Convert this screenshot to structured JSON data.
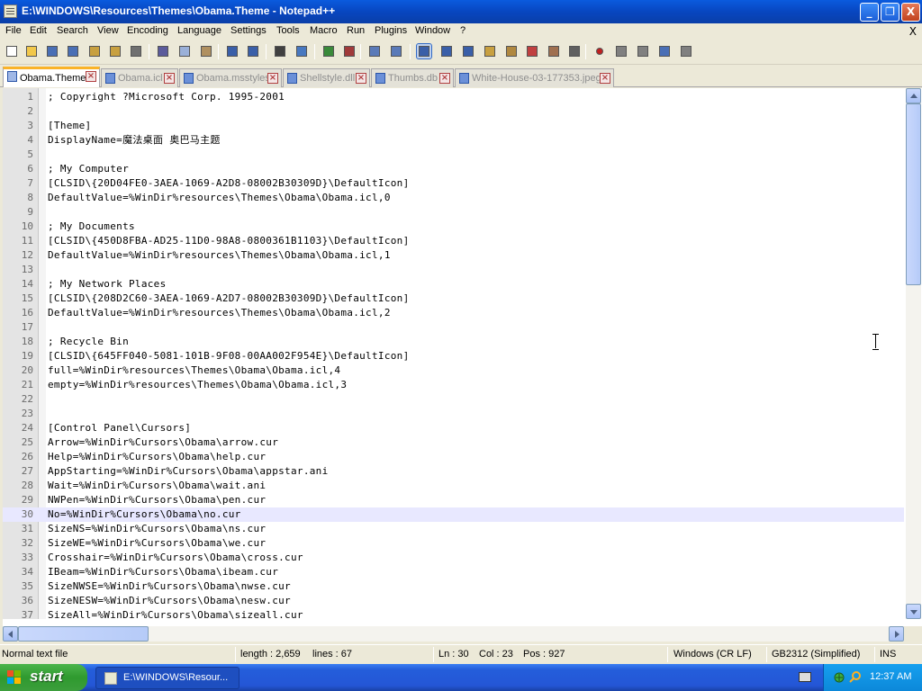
{
  "window": {
    "title": "E:\\WINDOWS\\Resources\\Themes\\Obama.Theme - Notepad++",
    "minimize_glyph": "_",
    "maximize_glyph": "❐",
    "close_glyph": "X"
  },
  "menu": {
    "items": [
      "File",
      "Edit",
      "Search",
      "View",
      "Encoding",
      "Language",
      "Settings",
      "Tools",
      "Macro",
      "Run",
      "Plugins",
      "Window",
      "?"
    ],
    "doc_close": "X"
  },
  "toolbar": {
    "buttons": [
      {
        "name": "new-file-icon",
        "color": "#ffffff"
      },
      {
        "name": "open-file-icon",
        "color": "#f2c84b"
      },
      {
        "name": "save-icon",
        "color": "#4a6fb5"
      },
      {
        "name": "save-all-icon",
        "color": "#4a6fb5"
      },
      {
        "name": "close-icon",
        "color": "#c8a040"
      },
      {
        "name": "close-all-icon",
        "color": "#c8a040"
      },
      {
        "name": "print-icon",
        "color": "#707070"
      },
      {
        "name": "cut-icon",
        "color": "#5b5b9b"
      },
      {
        "name": "copy-icon",
        "color": "#9ab0d8"
      },
      {
        "name": "paste-icon",
        "color": "#b09060"
      },
      {
        "name": "undo-icon",
        "color": "#3a5fa8"
      },
      {
        "name": "redo-icon",
        "color": "#3a5fa8"
      },
      {
        "name": "find-icon",
        "color": "#404040"
      },
      {
        "name": "replace-icon",
        "color": "#4878c0"
      },
      {
        "name": "zoom-in-icon",
        "color": "#3a8a3a"
      },
      {
        "name": "zoom-out-icon",
        "color": "#a03a3a"
      },
      {
        "name": "sync-scroll-icon",
        "color": "#5a7ab8"
      },
      {
        "name": "sync-scroll-h-icon",
        "color": "#5a7ab8"
      },
      {
        "name": "word-wrap-icon",
        "color": "#3a5fa8"
      },
      {
        "name": "show-all-chars-icon",
        "color": "#3a5fa8"
      },
      {
        "name": "indent-guide-icon",
        "color": "#3a5fa8"
      },
      {
        "name": "language-icon",
        "color": "#c8a040"
      },
      {
        "name": "user-lang-icon",
        "color": "#b08840"
      },
      {
        "name": "doc-map-icon",
        "color": "#c04040"
      },
      {
        "name": "function-list-icon",
        "color": "#a07050"
      },
      {
        "name": "monitoring-icon",
        "color": "#606060"
      },
      {
        "name": "record-macro-icon",
        "color": "#c02020"
      },
      {
        "name": "stop-macro-icon",
        "color": "#808080"
      },
      {
        "name": "play-macro-icon",
        "color": "#808080"
      },
      {
        "name": "run-macro-multiple-icon",
        "color": "#4a6fb5"
      },
      {
        "name": "save-macro-icon",
        "color": "#808080"
      }
    ]
  },
  "tabs": [
    {
      "label": "Obama.Theme",
      "active": true
    },
    {
      "label": "Obama.icl",
      "active": false
    },
    {
      "label": "Obama.msstyles",
      "active": false
    },
    {
      "label": "Shellstyle.dll",
      "active": false
    },
    {
      "label": "Thumbs.db",
      "active": false
    },
    {
      "label": "White-House-03-177353.jpeg",
      "active": false
    }
  ],
  "editor": {
    "current_line": 30,
    "lines": [
      "; Copyright ?Microsoft Corp. 1995-2001",
      "",
      "[Theme]",
      "DisplayName=魔法桌面 奥巴马主题",
      "",
      "; My Computer",
      "[CLSID\\{20D04FE0-3AEA-1069-A2D8-08002B30309D}\\DefaultIcon]",
      "DefaultValue=%WinDir%resources\\Themes\\Obama\\Obama.icl,0",
      "",
      "; My Documents",
      "[CLSID\\{450D8FBA-AD25-11D0-98A8-0800361B1103}\\DefaultIcon]",
      "DefaultValue=%WinDir%resources\\Themes\\Obama\\Obama.icl,1",
      "",
      "; My Network Places",
      "[CLSID\\{208D2C60-3AEA-1069-A2D7-08002B30309D}\\DefaultIcon]",
      "DefaultValue=%WinDir%resources\\Themes\\Obama\\Obama.icl,2",
      "",
      "; Recycle Bin",
      "[CLSID\\{645FF040-5081-101B-9F08-00AA002F954E}\\DefaultIcon]",
      "full=%WinDir%resources\\Themes\\Obama\\Obama.icl,4",
      "empty=%WinDir%resources\\Themes\\Obama\\Obama.icl,3",
      "",
      "",
      "[Control Panel\\Cursors]",
      "Arrow=%WinDir%Cursors\\Obama\\arrow.cur",
      "Help=%WinDir%Cursors\\Obama\\help.cur",
      "AppStarting=%WinDir%Cursors\\Obama\\appstar.ani",
      "Wait=%WinDir%Cursors\\Obama\\wait.ani",
      "NWPen=%WinDir%Cursors\\Obama\\pen.cur",
      "No=%WinDir%Cursors\\Obama\\no.cur",
      "SizeNS=%WinDir%Cursors\\Obama\\ns.cur",
      "SizeWE=%WinDir%Cursors\\Obama\\we.cur",
      "Crosshair=%WinDir%Cursors\\Obama\\cross.cur",
      "IBeam=%WinDir%Cursors\\Obama\\ibeam.cur",
      "SizeNWSE=%WinDir%Cursors\\Obama\\nwse.cur",
      "SizeNESW=%WinDir%Cursors\\Obama\\nesw.cur",
      "SizeAll=%WinDir%Cursors\\Obama\\sizeall.cur"
    ]
  },
  "status": {
    "file_type": "Normal text file",
    "length": "length : 2,659",
    "lines": "lines : 67",
    "ln": "Ln : 30",
    "col": "Col : 23",
    "pos": "Pos : 927",
    "eol": "Windows (CR LF)",
    "encoding": "GB2312 (Simplified)",
    "mode": "INS"
  },
  "taskbar": {
    "start_label": "start",
    "task_label": "E:\\WINDOWS\\Resour...",
    "clock": "12:37 AM"
  },
  "colors": {
    "active_tab_accent": "#fab328",
    "current_line_bg": "#e8e8ff",
    "taskbar_blue": "#245edb",
    "start_green": "#2f9a2f",
    "tray_blue": "#0c88d9"
  }
}
